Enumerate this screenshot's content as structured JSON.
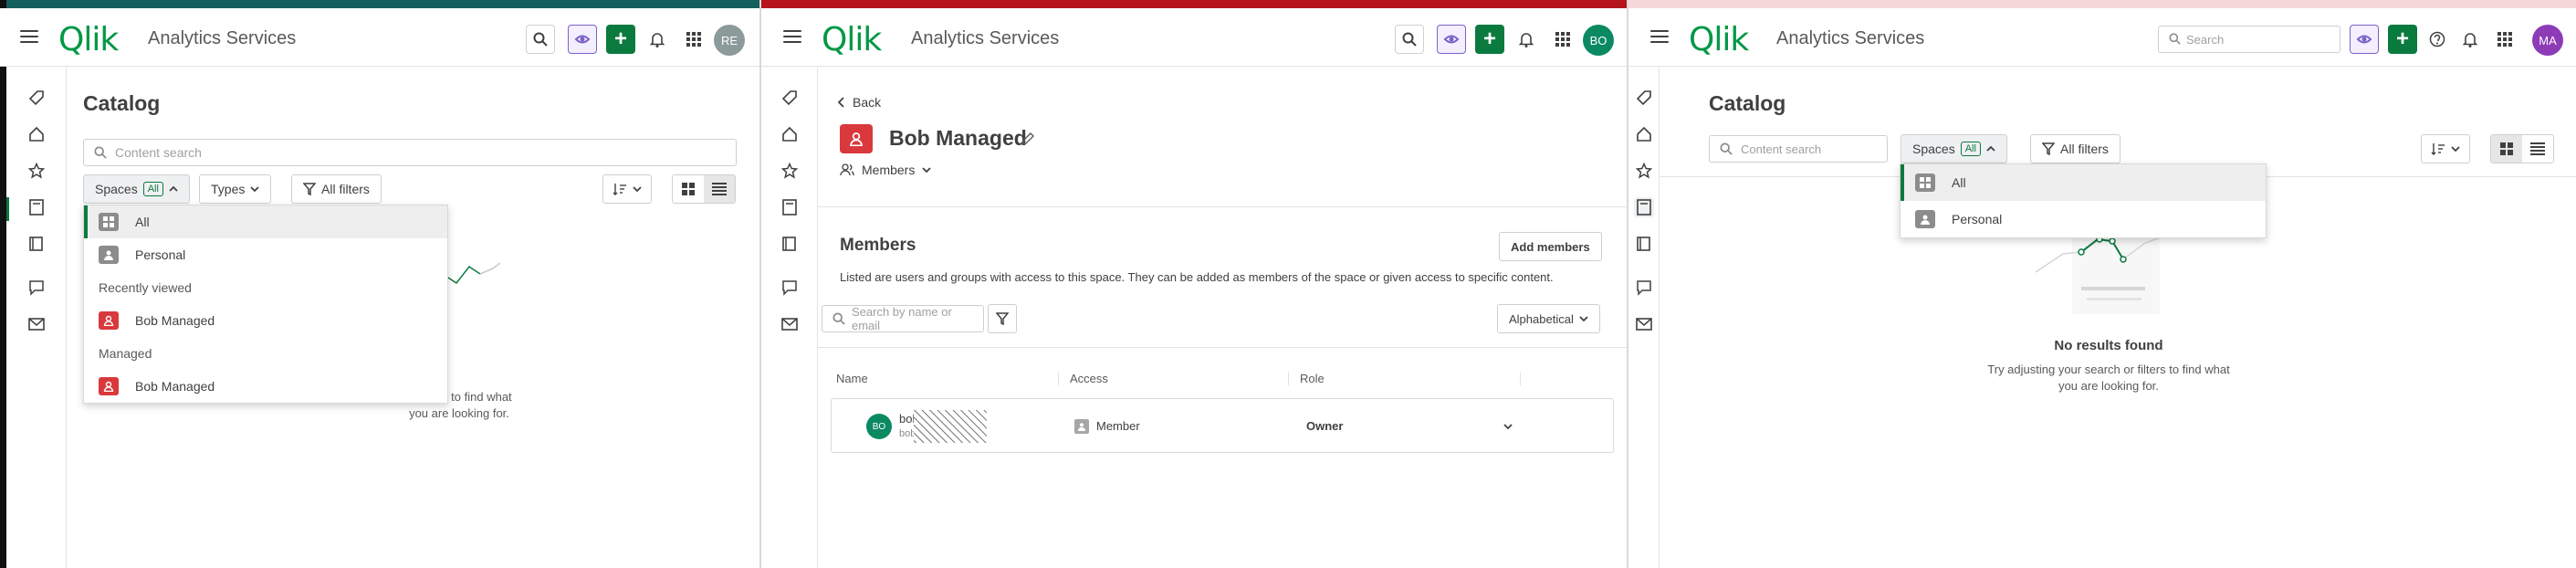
{
  "colors": {
    "brand_green": "#009845",
    "accent_green": "#0b7a3e",
    "purple": "#7b61c8",
    "red": "#d9393d",
    "stripe_teal": "#13605f",
    "stripe_red": "#b5141c",
    "stripe_pink": "#f7d8d8"
  },
  "panel1": {
    "app_title": "Analytics Services",
    "avatar_initials": "RE",
    "page_title": "Catalog",
    "search_placeholder": "Content search",
    "spaces_label": "Spaces",
    "spaces_badge": "All",
    "types_label": "Types",
    "all_filters_label": "All filters",
    "dropdown": {
      "items": [
        "All",
        "Personal"
      ],
      "recently_viewed_heading": "Recently viewed",
      "recently_viewed": [
        "Bob Managed"
      ],
      "managed_heading": "Managed",
      "managed": [
        "Bob Managed"
      ]
    },
    "noresults_title_partial": "nd",
    "noresults_line1_partial": "lters to find what",
    "noresults_line2": "you are looking for."
  },
  "panel2": {
    "app_title": "Analytics Services",
    "avatar_initials": "BO",
    "back_label": "Back",
    "space_name": "Bob Managed",
    "members_tab": "Members",
    "section_title": "Members",
    "add_members": "Add members",
    "description": "Listed are users and groups with access to this space. They can be added as members of the space or given access to specific content.",
    "search_placeholder": "Search by name or email",
    "sort_label": "Alphabetical",
    "columns": [
      "Name",
      "Access",
      "Role"
    ],
    "row": {
      "initials": "BO",
      "name": "bob",
      "email": "bob",
      "access": "Member",
      "role": "Owner"
    }
  },
  "panel3": {
    "app_title": "Analytics Services",
    "avatar_initials": "MA",
    "header_search_placeholder": "Search",
    "page_title": "Catalog",
    "search_placeholder": "Content search",
    "spaces_label": "Spaces",
    "spaces_badge": "All",
    "all_filters_label": "All filters",
    "dropdown": {
      "items": [
        "All",
        "Personal"
      ]
    },
    "noresults_title": "No results found",
    "noresults_line1": "Try adjusting your search or filters to find what",
    "noresults_line2": "you are looking for."
  }
}
